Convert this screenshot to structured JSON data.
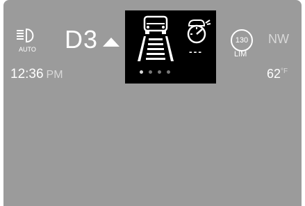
{
  "lighting": {
    "mode": "AUTO",
    "icon": "auto-headlight-icon"
  },
  "transmission": {
    "gear": "D3",
    "indicator": "upshift-arrow-icon"
  },
  "time": {
    "value": "12:36",
    "period": "PM"
  },
  "center_panel": {
    "lane_icon": "lane-assist-car-icon",
    "cruise_icon": "adaptive-cruise-icon",
    "cruise_set_speed": "---",
    "page_count": 4,
    "active_page": 1
  },
  "speed_limit": {
    "value": "130",
    "label": "LIM"
  },
  "compass": {
    "heading": "NW"
  },
  "temperature": {
    "value": "62",
    "unit": "°F"
  },
  "colors": {
    "background": "#9b9b9b",
    "panel": "#000000",
    "text": "#ffffff"
  }
}
